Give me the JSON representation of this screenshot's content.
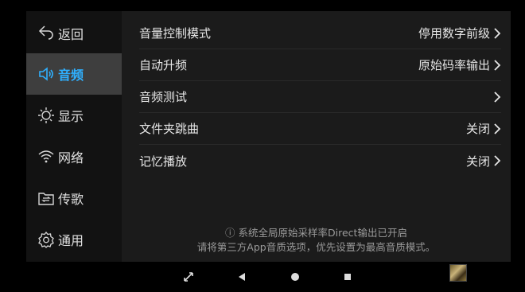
{
  "sidebar": {
    "items": [
      {
        "label": "返回",
        "icon": "back-icon",
        "active": false
      },
      {
        "label": "音频",
        "icon": "speaker-icon",
        "active": true
      },
      {
        "label": "显示",
        "icon": "brightness-icon",
        "active": false
      },
      {
        "label": "网络",
        "icon": "wifi-icon",
        "active": false
      },
      {
        "label": "传歌",
        "icon": "transfer-icon",
        "active": false
      },
      {
        "label": "通用",
        "icon": "gear-icon",
        "active": false
      }
    ]
  },
  "settings": {
    "rows": [
      {
        "label": "音量控制模式",
        "value": "停用数字前级"
      },
      {
        "label": "自动升频",
        "value": "原始码率输出"
      },
      {
        "label": "音频测试",
        "value": ""
      },
      {
        "label": "文件夹跳曲",
        "value": "关闭"
      },
      {
        "label": "记忆播放",
        "value": "关闭"
      }
    ]
  },
  "note": {
    "line1": "ⓘ 系统全局原始采样率Direct输出已开启",
    "line2": "请将第三方App音质选项，优先设置为最高音质模式。"
  },
  "colors": {
    "accent": "#2fb0ff",
    "background": "#1b1b1b",
    "sidebar": "#121212"
  }
}
